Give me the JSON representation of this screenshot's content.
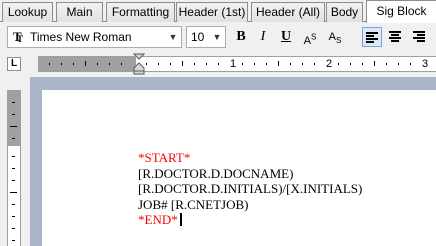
{
  "tabs": [
    {
      "label": "Lookup",
      "active": false
    },
    {
      "label": "Main",
      "active": false
    },
    {
      "label": "Formatting",
      "active": false
    },
    {
      "label": "Header (1st)",
      "active": false
    },
    {
      "label": "Header (All)",
      "active": false
    },
    {
      "label": "Body",
      "active": false
    },
    {
      "label": "Sig Block",
      "active": true
    }
  ],
  "toolbar": {
    "font_icon": "truetype-font-icon",
    "font_name": "Times New Roman",
    "font_size": "10",
    "bold_label": "B",
    "italic_label": "I",
    "underline_label": "U",
    "superscript_label": "AS",
    "subscript_label": "AS",
    "align_options": [
      "left",
      "center",
      "right"
    ],
    "active_align": "left",
    "active_color": "#dbe9f7"
  },
  "ruler": {
    "tab_selector": "L",
    "numbers": [
      "1",
      "2",
      "3"
    ]
  },
  "document": {
    "lines": [
      {
        "text": "*START*",
        "color": "#ff0000"
      },
      {
        "text": "[R.DOCTOR.D.DOCNAME)",
        "color": "#000000"
      },
      {
        "text": "[R.DOCTOR.D.INITIALS)/[X.INITIALS)",
        "color": "#000000"
      },
      {
        "text": "JOB#  [R.CNETJOB)",
        "color": "#000000"
      },
      {
        "text": "*END*",
        "color": "#ff0000"
      }
    ]
  }
}
